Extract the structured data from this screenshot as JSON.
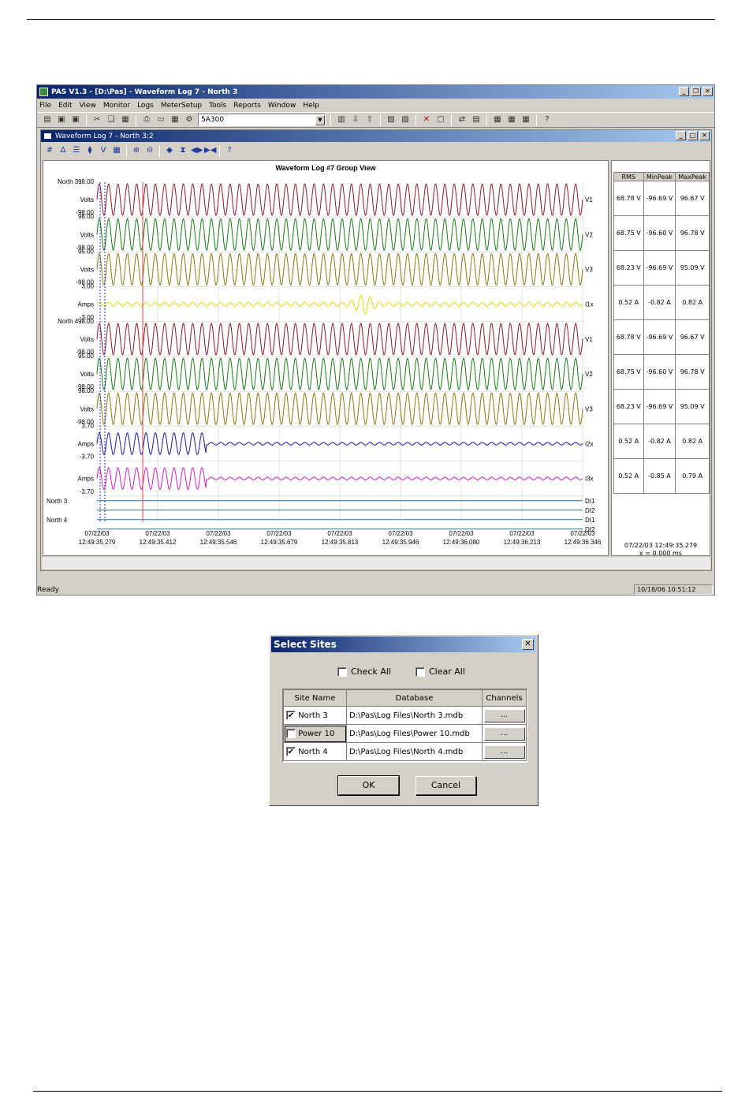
{
  "app": {
    "title": "PAS V1.3 - [D:\\Pas] - Waveform Log 7 - North 3",
    "menu": [
      "File",
      "Edit",
      "View",
      "Monitor",
      "Logs",
      "MeterSetup",
      "Tools",
      "Reports",
      "Window",
      "Help"
    ],
    "device_combo": "5A300",
    "status_left": "Ready",
    "status_right": "10/18/06 10:51:12"
  },
  "child": {
    "title": "Waveform Log 7 - North 3:2",
    "plot_title": "Waveform Log #7 Group View",
    "side_headers": [
      "RMS",
      "MinPeak",
      "MaxPeak"
    ],
    "side_rows": [
      [
        "68.78 V",
        "-96.69 V",
        "96.67 V"
      ],
      [
        "68.75 V",
        "-96.60 V",
        "96.78 V"
      ],
      [
        "68.23 V",
        "-96.69 V",
        "95.09 V"
      ],
      [
        "0.52 A",
        "-0.82 A",
        "0.82 A"
      ],
      [
        "68.78 V",
        "-96.69 V",
        "96.67 V"
      ],
      [
        "68.75 V",
        "-96.60 V",
        "96.78 V"
      ],
      [
        "68.23 V",
        "-96.69 V",
        "95.09 V"
      ],
      [
        "0.52 A",
        "-0.82 A",
        "0.82 A"
      ],
      [
        "0.52 A",
        "-0.85 A",
        "0.79 A"
      ]
    ],
    "cursor_date": "07/22/03  12:49:35.279",
    "cursor_delta": "x = 0.000 ms"
  },
  "chart_data": {
    "type": "line",
    "title": "Waveform Log #7 Group View",
    "x_dates": [
      "07/22/03",
      "07/22/03",
      "07/22/03",
      "07/22/03",
      "07/22/03",
      "07/22/03",
      "07/22/03",
      "07/22/03",
      "07/22/03"
    ],
    "x_times": [
      "12:49:35.279",
      "12:49:35.412",
      "12:49:35.546",
      "12:49:35.679",
      "12:49:35.813",
      "12:49:35.946",
      "12:49:36.080",
      "12:49:36.213",
      "12:49:36.346"
    ],
    "channels": [
      {
        "site": "North 3 :",
        "top": "98.00",
        "unit": "Volts",
        "bottom": "-98.00",
        "name": "V1",
        "color": "#8b1a2a",
        "kind": "sine"
      },
      {
        "site": "",
        "top": "98.00",
        "unit": "Volts",
        "bottom": "-98.00",
        "name": "V2",
        "color": "#1a7a1a",
        "kind": "sine"
      },
      {
        "site": "",
        "top": "95.00",
        "unit": "Volts",
        "bottom": "-98.00",
        "name": "V3",
        "color": "#8a7a10",
        "kind": "sine"
      },
      {
        "site": "",
        "top": "3.00",
        "unit": "Amps",
        "bottom": "-3.00",
        "name": "I1x",
        "color": "#e0e000",
        "kind": "small"
      },
      {
        "site": "North 4 :",
        "top": "98.00",
        "unit": "Volts",
        "bottom": "-98.00",
        "name": "V1",
        "color": "#8b1a2a",
        "kind": "sine"
      },
      {
        "site": "",
        "top": "95.00",
        "unit": "Volts",
        "bottom": "-98.00",
        "name": "V2",
        "color": "#1a7a1a",
        "kind": "sine"
      },
      {
        "site": "",
        "top": "98.00",
        "unit": "Volts",
        "bottom": "-98.00",
        "name": "V3",
        "color": "#8a7a10",
        "kind": "sine"
      },
      {
        "site": "",
        "top": "3.70",
        "unit": "Amps",
        "bottom": "-3.70",
        "name": "I2x",
        "color": "#1a1aa0",
        "kind": "burst"
      },
      {
        "site": "",
        "top": "",
        "unit": "Amps",
        "bottom": "-3.70",
        "name": "I3x",
        "color": "#d020c0",
        "kind": "burst"
      }
    ],
    "digital": [
      {
        "site": "North 3",
        "name": "DI1"
      },
      {
        "site": "",
        "name": "DI2"
      },
      {
        "site": "North 4",
        "name": "DI1"
      },
      {
        "site": "",
        "name": "DI2"
      }
    ]
  },
  "dialog": {
    "title": "Select Sites",
    "check_all": "Check All",
    "clear_all": "Clear All",
    "headers": [
      "Site Name",
      "Database",
      "Channels"
    ],
    "rows": [
      {
        "site": "North 3",
        "checked": true,
        "db": "D:\\Pas\\Log Files\\North 3.mdb",
        "ch": "..."
      },
      {
        "site": "Power 10",
        "checked": false,
        "db": "D:\\Pas\\Log Files\\Power 10.mdb",
        "ch": "..."
      },
      {
        "site": "North 4",
        "checked": true,
        "db": "D:\\Pas\\Log Files\\North 4.mdb",
        "ch": "..."
      }
    ],
    "ok": "OK",
    "cancel": "Cancel"
  }
}
